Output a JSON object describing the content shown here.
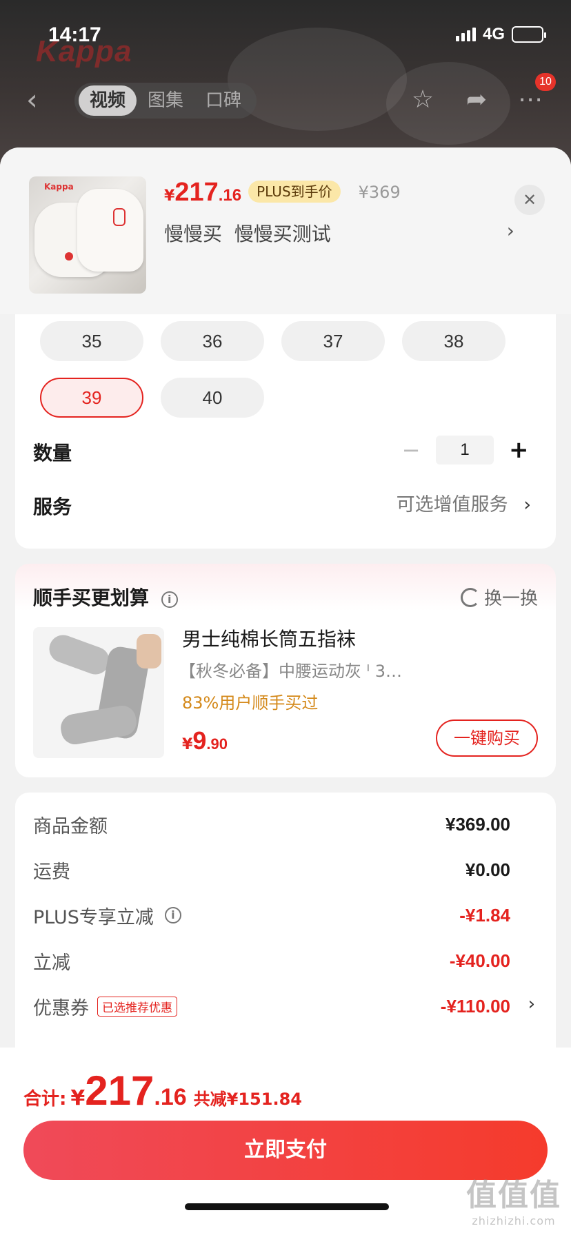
{
  "status_bar": {
    "time": "14:17",
    "network": "4G"
  },
  "header": {
    "brand_watermark": "Kappa",
    "tabs": [
      {
        "label": "视频",
        "active": true
      },
      {
        "label": "图集",
        "active": false
      },
      {
        "label": "口碑",
        "active": false
      }
    ],
    "more_badge": "10"
  },
  "product": {
    "price_currency": "¥",
    "price_integer": "217",
    "price_decimal": ".16",
    "plus_tag": "PLUS到手价",
    "original_price": "¥369",
    "selected_spec": "慢慢买  慢慢买测试"
  },
  "sizes": [
    {
      "label": "35",
      "selected": false
    },
    {
      "label": "36",
      "selected": false
    },
    {
      "label": "37",
      "selected": false
    },
    {
      "label": "38",
      "selected": false
    },
    {
      "label": "39",
      "selected": true
    },
    {
      "label": "40",
      "selected": false
    }
  ],
  "quantity": {
    "label": "数量",
    "value": "1",
    "minus": "−",
    "plus": "+"
  },
  "service": {
    "label": "服务",
    "value": "可选增值服务"
  },
  "recommend": {
    "title": "顺手买更划算",
    "swap_label": "换一换",
    "item": {
      "name": "男士纯棉长筒五指袜",
      "spec": "【秋冬必备】中腰运动灰 ᴵ 3…",
      "bought": "83%用户顺手买过",
      "price_currency": "¥",
      "price_integer": "9",
      "price_decimal": ".90",
      "buy_label": "一键购买"
    }
  },
  "summary": {
    "rows": [
      {
        "label": "商品金额",
        "value": "¥369.00"
      },
      {
        "label": "运费",
        "value": "¥0.00"
      },
      {
        "label": "PLUS专享立减",
        "value": "-¥1.84"
      },
      {
        "label": "立减",
        "value": "-¥40.00"
      },
      {
        "label": "优惠券",
        "value": "-¥110.00",
        "tag": "已选推荐优惠"
      }
    ]
  },
  "footer": {
    "total_label": "合计:",
    "total_currency": "¥",
    "total_integer": "217",
    "total_decimal": ".16",
    "total_saving": "共减¥151.84",
    "pay_label": "立即支付"
  },
  "watermark": {
    "main": "值值值",
    "sub": "zhizhizhi.com"
  },
  "colors": {
    "accent": "#e4231f",
    "plus_tag_bg": "#fbe7a8",
    "bought_text": "#d4891a"
  }
}
